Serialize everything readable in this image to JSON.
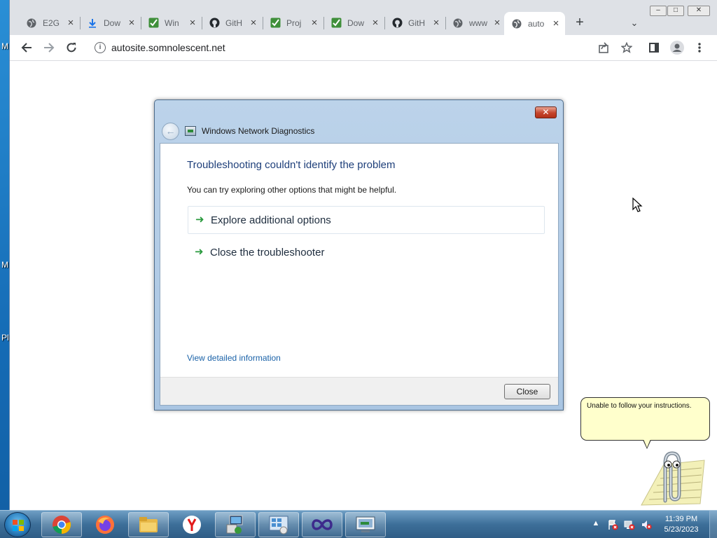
{
  "desktop": {
    "letters": [
      "M",
      "M",
      "Pl"
    ]
  },
  "browser": {
    "tabs": [
      {
        "title": "E2G",
        "icon": "globe-icon"
      },
      {
        "title": "Dow",
        "icon": "download-icon"
      },
      {
        "title": "Win",
        "icon": "checkmark-icon"
      },
      {
        "title": "GitH",
        "icon": "github-icon"
      },
      {
        "title": "Proj",
        "icon": "checkmark-icon"
      },
      {
        "title": "Dow",
        "icon": "checkmark-icon"
      },
      {
        "title": "GitH",
        "icon": "github-icon"
      },
      {
        "title": "www",
        "icon": "globe-icon"
      },
      {
        "title": "auto",
        "icon": "globe-icon",
        "active": true
      }
    ],
    "url": "autosite.somnolescent.net"
  },
  "dialog": {
    "title": "Windows Network Diagnostics",
    "heading": "Troubleshooting couldn't identify the problem",
    "subtext": "You can try exploring other options that might be helpful.",
    "options": [
      "Explore additional options",
      "Close the troubleshooter"
    ],
    "details_link": "View detailed information",
    "close_button": "Close"
  },
  "assistant": {
    "message": "Unable to follow your instructions."
  },
  "taskbar": {
    "apps": [
      "chrome",
      "firefox",
      "file-explorer",
      "yandex",
      "network-setup",
      "control-panel",
      "visual-studio",
      "diagnostics"
    ],
    "time": "11:39 PM",
    "date": "5/23/2023"
  },
  "colors": {
    "heading": "#1e3f7a",
    "link": "#1a62a8",
    "arrow": "#2a9a3e",
    "balloon": "#ffffcc"
  }
}
